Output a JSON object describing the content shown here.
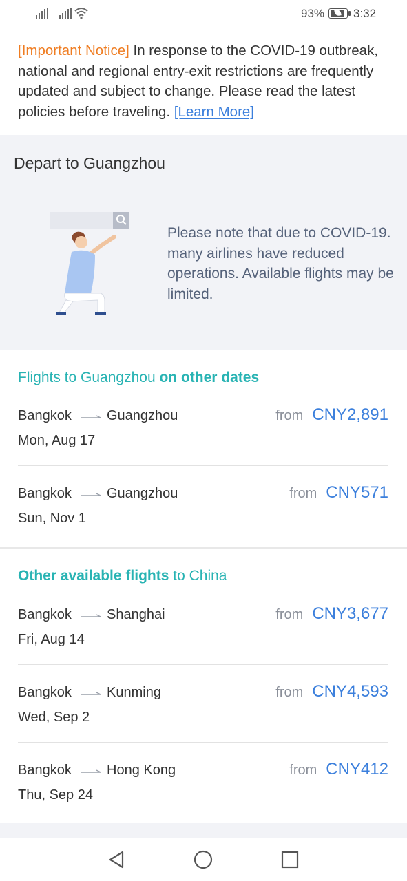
{
  "status_bar": {
    "battery_percent": "93%",
    "battery_level": 0.93,
    "time": "3:32",
    "icons": [
      "signal-icon",
      "signal-icon",
      "wifi-icon",
      "battery-icon"
    ]
  },
  "notice": {
    "tag": "[Important Notice]",
    "text": " In response to the COVID-19 outbreak, national and regional entry-exit restrictions are frequently updated and subject to change. Please read the latest policies before traveling. ",
    "link": "[Learn More]"
  },
  "panel": {
    "title": "Depart to Guangzhou",
    "message": "Please note that due to COVID-19. many airlines have reduced operations. Available flights may be limited."
  },
  "other_dates": {
    "heading_plain": "Flights to Guangzhou",
    "heading_bold": "on other dates",
    "flights": [
      {
        "from": "Bangkok",
        "to": "Guangzhou",
        "date": "Mon, Aug 17",
        "from_label": "from",
        "price": "CNY2,891"
      },
      {
        "from": "Bangkok",
        "to": "Guangzhou",
        "date": "Sun, Nov 1",
        "from_label": "from",
        "price": "CNY571"
      }
    ]
  },
  "other_flights": {
    "heading_bold": "Other available flights",
    "heading_plain": "to China",
    "flights": [
      {
        "from": "Bangkok",
        "to": "Shanghai",
        "date": "Fri, Aug 14",
        "from_label": "from",
        "price": "CNY3,677"
      },
      {
        "from": "Bangkok",
        "to": "Kunming",
        "date": "Wed, Sep 2",
        "from_label": "from",
        "price": "CNY4,593"
      },
      {
        "from": "Bangkok",
        "to": "Hong Kong",
        "date": "Thu, Sep 24",
        "from_label": "from",
        "price": "CNY412"
      }
    ]
  },
  "colors": {
    "accent_teal": "#28b3b3",
    "price_blue": "#3b7fdc",
    "notice_orange": "#ef7d22",
    "panel_bg": "#f2f3f7"
  },
  "nav_bar": {
    "buttons": [
      "back-icon",
      "home-icon",
      "recents-icon"
    ]
  }
}
